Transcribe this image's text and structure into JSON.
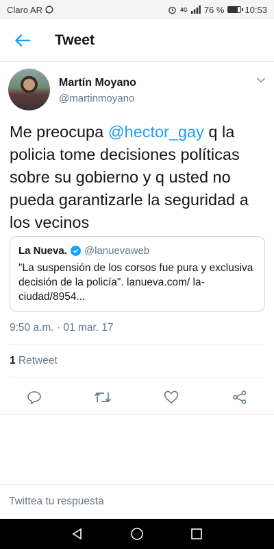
{
  "status_bar": {
    "carrier": "Claro AR",
    "network": "4G",
    "battery_percent": "76 %",
    "battery_level": 0.76,
    "time": "10:53",
    "icons": [
      "whatsapp-icon",
      "alarm-icon",
      "signal-icon",
      "battery-icon"
    ]
  },
  "app_bar": {
    "title": "Tweet",
    "back_icon": "arrow-left-icon"
  },
  "tweet": {
    "author_name": "Martín Moyano",
    "author_handle": "@martinmoyano",
    "text_before": "Me preocupa ",
    "mention": "@hector_gay",
    "text_after": "  q la policia tome decisiones políticas sobre su gobierno y q usted no pueda garantizarle la seguridad a los vecinos",
    "quote": {
      "name": "La Nueva.",
      "handle": "@lanuevaweb",
      "text": "\"La suspensión de los corsos fue pura y exclusiva decisión de la policía\". lanueva.com/ la-ciudad/8954..."
    },
    "timestamp": "9:50 a.m. · 01 mar. 17",
    "retweet_count": "1",
    "retweet_label": "Retweet"
  },
  "actions": [
    "reply-icon",
    "retweet-icon",
    "like-icon",
    "share-icon"
  ],
  "reply": {
    "placeholder": "Twittea tu respuesta"
  },
  "colors": {
    "accent": "#1da1f2",
    "secondary_text": "#657786",
    "divider": "#e1e8ed"
  }
}
